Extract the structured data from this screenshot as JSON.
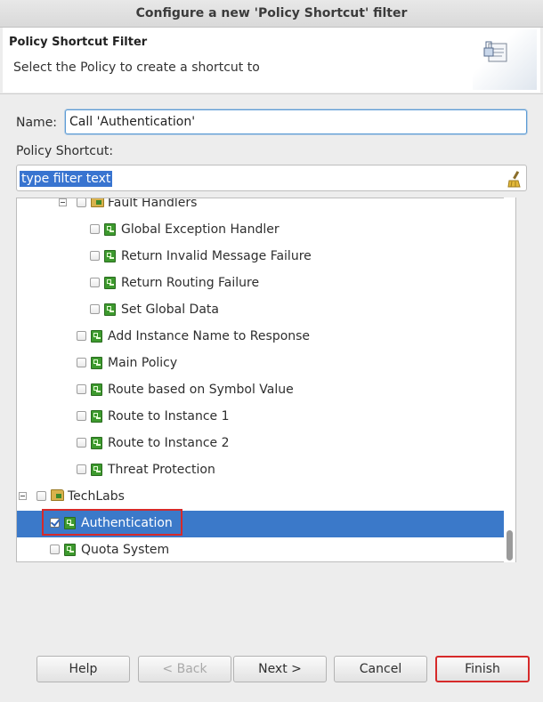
{
  "window": {
    "title": "Configure a new 'Policy Shortcut' filter"
  },
  "header": {
    "title": "Policy Shortcut Filter",
    "description": "Select the Policy to create a shortcut to"
  },
  "form": {
    "name_label": "Name:",
    "name_value": "Call 'Authentication'",
    "policy_shortcut_label": "Policy Shortcut:",
    "filter_text": "type filter text"
  },
  "tree": {
    "items": [
      {
        "label": "Fault Handlers",
        "type": "folder",
        "expanded": true,
        "checked": false
      },
      {
        "label": "Global Exception Handler",
        "type": "policy",
        "checked": false
      },
      {
        "label": "Return Invalid Message Failure",
        "type": "policy",
        "checked": false
      },
      {
        "label": "Return Routing Failure",
        "type": "policy",
        "checked": false
      },
      {
        "label": "Set Global Data",
        "type": "policy",
        "checked": false
      },
      {
        "label": "Add Instance Name to Response",
        "type": "policy",
        "checked": false
      },
      {
        "label": "Main Policy",
        "type": "policy",
        "checked": false
      },
      {
        "label": "Route based on Symbol Value",
        "type": "policy",
        "checked": false
      },
      {
        "label": "Route to Instance 1",
        "type": "policy",
        "checked": false
      },
      {
        "label": "Route to Instance 2",
        "type": "policy",
        "checked": false
      },
      {
        "label": "Threat Protection",
        "type": "policy",
        "checked": false
      },
      {
        "label": "TechLabs",
        "type": "folder",
        "expanded": true,
        "checked": false
      },
      {
        "label": "Authentication",
        "type": "policy",
        "checked": true,
        "selected": true
      },
      {
        "label": "Quota System",
        "type": "policy",
        "checked": false
      }
    ]
  },
  "buttons": {
    "help": "Help",
    "back": "< Back",
    "next": "Next >",
    "cancel": "Cancel",
    "finish": "Finish"
  },
  "colors": {
    "selection": "#3b79c9",
    "highlight_outline": "#d62a2a",
    "policy_icon": "#3d9a2e"
  }
}
